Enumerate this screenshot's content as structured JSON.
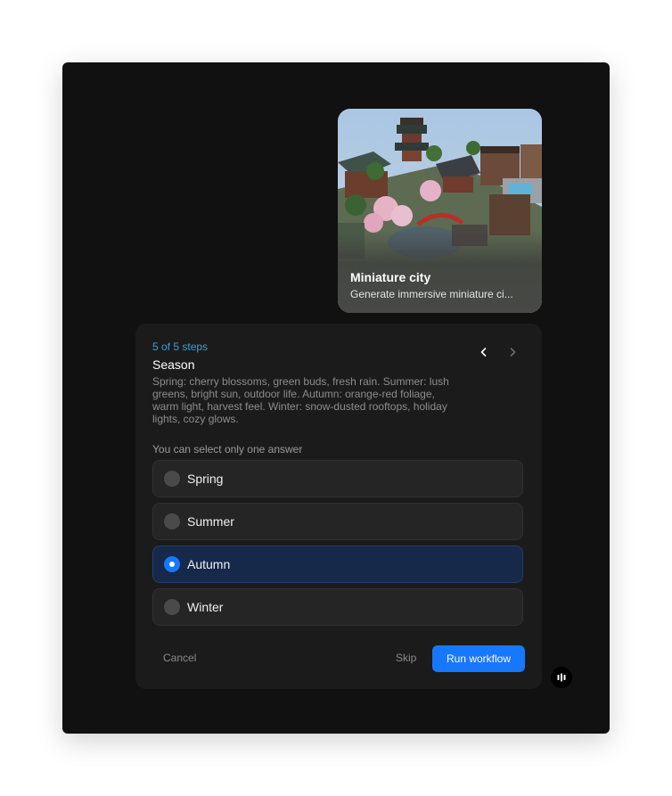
{
  "card": {
    "title": "Miniature city",
    "subtitle": "Generate immersive miniature ci..."
  },
  "panel": {
    "steps": "5 of 5 steps",
    "title": "Season",
    "description": "Spring: cherry blossoms, green buds, fresh rain. Summer: lush greens, bright sun, outdoor life. Autumn: orange-red foliage, warm light, harvest feel. Winter: snow-dusted rooftops, holiday lights, cozy glows.",
    "hint": "You can select only one answer",
    "options": [
      {
        "label": "Spring",
        "selected": false
      },
      {
        "label": "Summer",
        "selected": false
      },
      {
        "label": "Autumn",
        "selected": true
      },
      {
        "label": "Winter",
        "selected": false
      }
    ],
    "cancel_label": "Cancel",
    "skip_label": "Skip",
    "run_label": "Run workflow"
  },
  "icons": {
    "prev": "chevron-left-icon",
    "next": "chevron-right-icon",
    "logo": "app-logo-icon"
  },
  "colors": {
    "accent": "#1677ff",
    "steps": "#3d9fd8",
    "window_bg": "#111111",
    "panel_bg": "#1b1b1b",
    "selected_bg": "#16294a"
  }
}
